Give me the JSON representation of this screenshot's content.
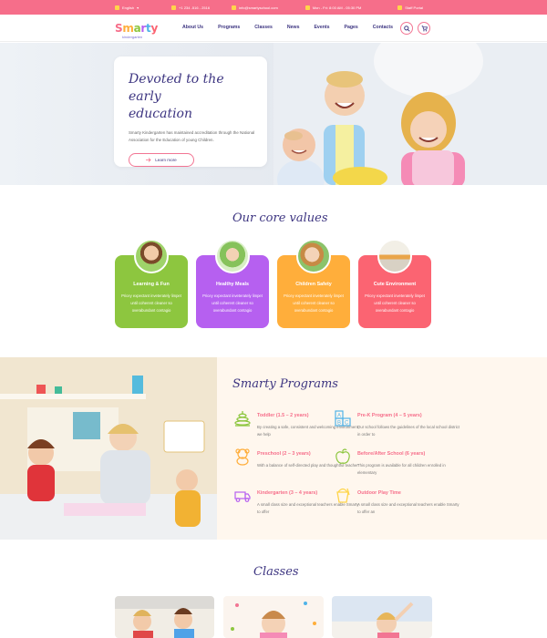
{
  "topbar": {
    "language": "English",
    "phone": "+1 234 -516 - 2516",
    "email": "info@smartyschool.com",
    "hours": "Mon - Fri: 8:00 AM - 05:30 PM",
    "login": "Staff Portal"
  },
  "brand": {
    "name": "Smarty",
    "sub": "kindergarten"
  },
  "nav": {
    "items": [
      "About Us",
      "Programs",
      "Classes",
      "News",
      "Events",
      "Pages",
      "Contacts"
    ]
  },
  "hero": {
    "title_line1": "Devoted to the early",
    "title_line2": "education",
    "text": "Smarty Kindergarten has maintained accreditation through the National Association for the Education of young Children.",
    "button": "Learn more"
  },
  "values": {
    "title": "Our core values",
    "cards": [
      {
        "title": "Learning & Fun",
        "text": "Pricey expectant inveterately limpet until coherent cleaner so overabundant contagio",
        "color": "#8dc63f"
      },
      {
        "title": "Healthy Meals",
        "text": "Pricey expectant inveterately limpet until coherent cleaner so overabundant contagio",
        "color": "#b660f0"
      },
      {
        "title": "Children Safety",
        "text": "Pricey expectant inveterately limpet until coherent cleaner so overabundant contagio",
        "color": "#ffae3b"
      },
      {
        "title": "Cute Environment",
        "text": "Pricey expectant inveterately limpet until coherent cleaner so overabundant contagio",
        "color": "#fb6472"
      }
    ]
  },
  "programs": {
    "title": "Smarty Programs",
    "items": [
      {
        "title": "Toddler (1.5 – 2 years)",
        "text": "By creating a safe, consistent and welcoming environment, we help",
        "icon": "stacking-rings-icon"
      },
      {
        "title": "Pre-K Program (4 – 5 years)",
        "text": "Our school follows the guidelines of the local school district in order to",
        "icon": "abc-blocks-icon"
      },
      {
        "title": "Preschool (2 – 3 years)",
        "text": "With a balance of self-directed play and thoughtful teacher",
        "icon": "teddy-bear-icon"
      },
      {
        "title": "Before/After School (6 years)",
        "text": "This program is available for all children enrolled in elementary",
        "icon": "apple-icon"
      },
      {
        "title": "Kindergarten (3 – 4 years)",
        "text": "A small class size and exceptional teachers enable Smarty to offer",
        "icon": "toy-truck-icon"
      },
      {
        "title": "Outdoor Play Time",
        "text": "A small class size and exceptional teachers enable Smarty to offer an",
        "icon": "sand-bucket-icon"
      }
    ]
  },
  "classes": {
    "title": "Classes"
  },
  "colors": {
    "accent": "#f66e8a",
    "navy": "#3d3581",
    "yellow": "#ffd54a"
  }
}
